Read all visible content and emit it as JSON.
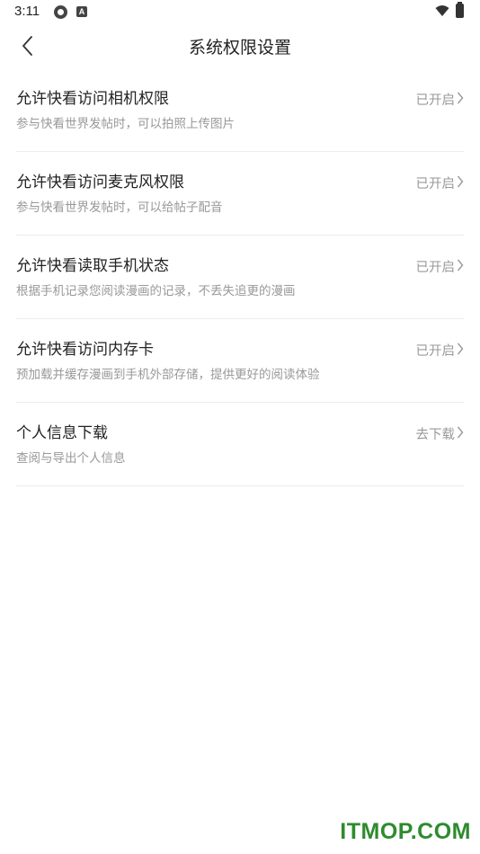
{
  "status_bar": {
    "time": "3:11",
    "badge_letter": "A"
  },
  "header": {
    "title": "系统权限设置"
  },
  "items": [
    {
      "title": "允许快看访问相机权限",
      "desc": "参与快看世界发帖时，可以拍照上传图片",
      "status": "已开启"
    },
    {
      "title": "允许快看访问麦克风权限",
      "desc": "参与快看世界发帖时，可以给帖子配音",
      "status": "已开启"
    },
    {
      "title": "允许快看读取手机状态",
      "desc": "根据手机记录您阅读漫画的记录，不丢失追更的漫画",
      "status": "已开启"
    },
    {
      "title": "允许快看访问内存卡",
      "desc": "预加载并缓存漫画到手机外部存储，提供更好的阅读体验",
      "status": "已开启"
    },
    {
      "title": "个人信息下载",
      "desc": "查阅与导出个人信息",
      "status": "去下载"
    }
  ],
  "watermark": "ITMOP.COM"
}
